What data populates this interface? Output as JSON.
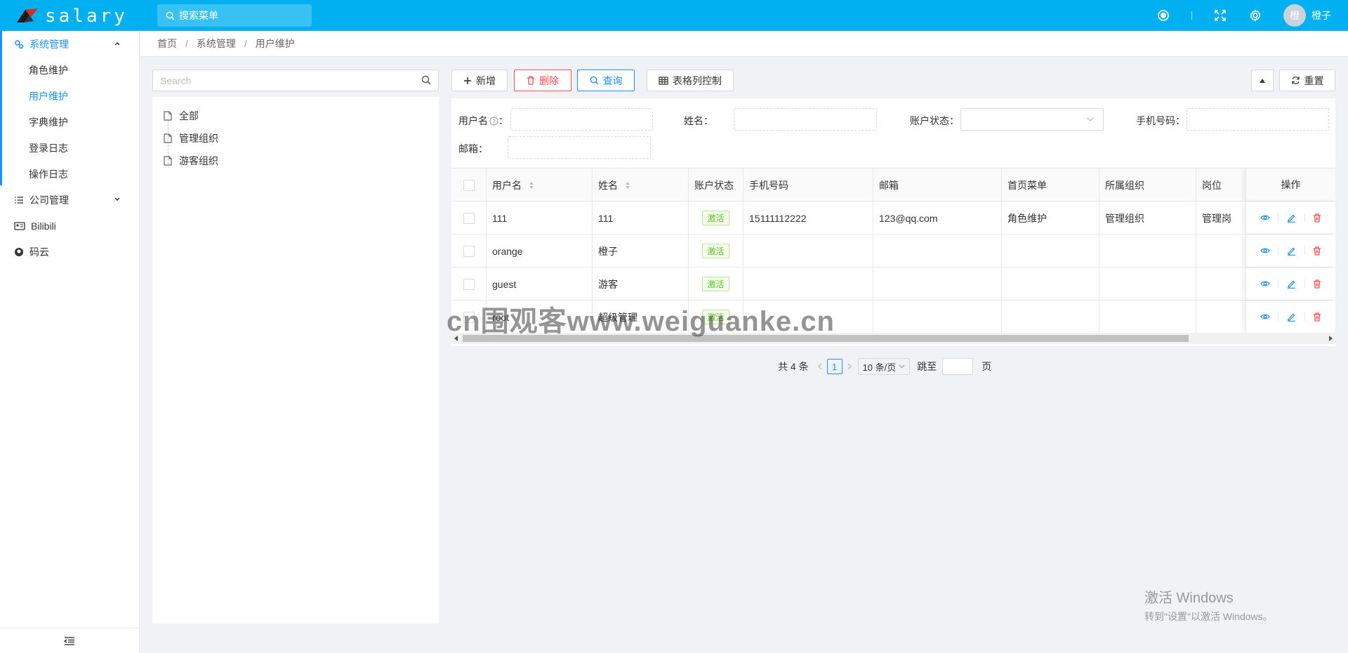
{
  "header": {
    "app_name": "salary",
    "menu_search_placeholder": "搜索菜单",
    "avatar_char": "橙",
    "username": "橙子"
  },
  "sidebar": {
    "groups": [
      {
        "label": "系统管理",
        "expanded": true,
        "items": [
          {
            "label": "角色维护"
          },
          {
            "label": "用户维护",
            "active": true
          },
          {
            "label": "字典维护"
          },
          {
            "label": "登录日志"
          },
          {
            "label": "操作日志"
          }
        ]
      },
      {
        "label": "公司管理",
        "expanded": false
      },
      {
        "label": "Bilibili"
      },
      {
        "label": "码云"
      }
    ]
  },
  "breadcrumb": [
    "首页",
    "系统管理",
    "用户维护"
  ],
  "tree": {
    "search_placeholder": "Search",
    "nodes": [
      "全部",
      "管理组织",
      "游客组织"
    ]
  },
  "toolbar": {
    "add": "新增",
    "delete": "删除",
    "query": "查询",
    "columns": "表格列控制",
    "reset": "重置"
  },
  "filters": {
    "username": "用户名",
    "name": "姓名：",
    "status": "账户状态：",
    "phone": "手机号码：",
    "email": "邮箱："
  },
  "table": {
    "columns": [
      "用户名",
      "姓名",
      "账户状态",
      "手机号码",
      "邮箱",
      "首页菜单",
      "所属组织",
      "岗位",
      "操作"
    ],
    "rows": [
      {
        "username": "111",
        "name": "111",
        "status": "激活",
        "phone": "15111112222",
        "email": "123@qq.com",
        "home_menu": "角色维护",
        "org": "管理组织",
        "post": "管理岗"
      },
      {
        "username": "orange",
        "name": "橙子",
        "status": "激活",
        "phone": "",
        "email": "",
        "home_menu": "",
        "org": "",
        "post": ""
      },
      {
        "username": "guest",
        "name": "游客",
        "status": "激活",
        "phone": "",
        "email": "",
        "home_menu": "",
        "org": "",
        "post": ""
      },
      {
        "username": "root",
        "name": "超级管理",
        "status": "激活",
        "phone": "",
        "email": "",
        "home_menu": "",
        "org": "",
        "post": ""
      }
    ]
  },
  "pagination": {
    "total": "共 4 条",
    "current": "1",
    "page_size": "10 条/页",
    "jump_label": "跳至",
    "page_unit": "页"
  },
  "overlay": {
    "watermark": "cn围观客www.weiguanke.cn",
    "activation_title": "激活 Windows",
    "activation_hint": "转到\"设置\"以激活 Windows。"
  },
  "colors": {
    "header_bg": "#00b0f0",
    "primary": "#1890ff",
    "danger": "#ff4d4f",
    "success": "#52c41a"
  }
}
